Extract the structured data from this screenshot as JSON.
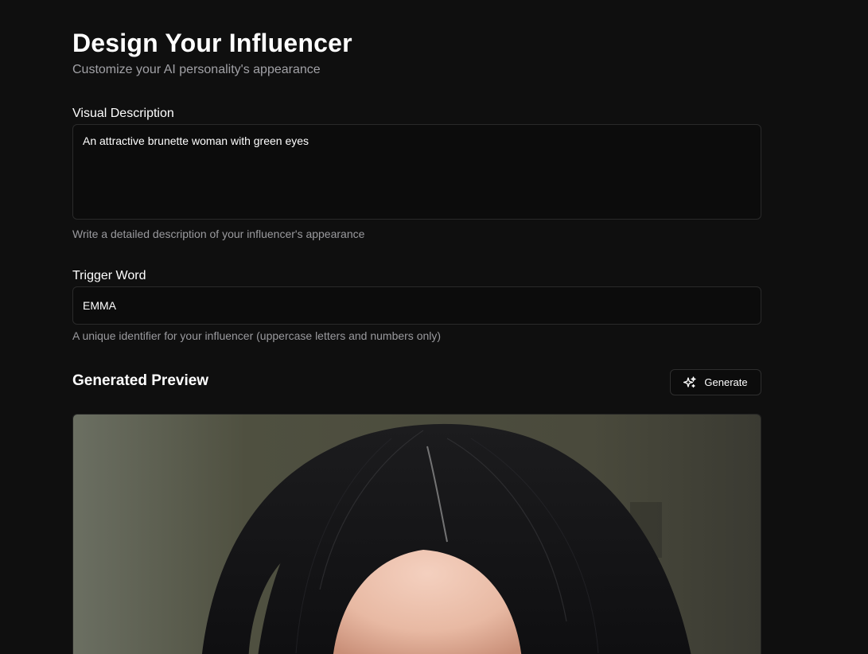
{
  "header": {
    "title": "Design Your Influencer",
    "subtitle": "Customize your AI personality's appearance"
  },
  "visual_description": {
    "label": "Visual Description",
    "value": "An attractive brunette woman with green eyes",
    "helper": "Write a detailed description of your influencer's appearance"
  },
  "trigger_word": {
    "label": "Trigger Word",
    "value": "EMMA",
    "helper": "A unique identifier for your influencer (uppercase letters and numbers only)"
  },
  "preview": {
    "title": "Generated Preview",
    "generate_label": "Generate",
    "generate_icon": "sparkles-icon"
  },
  "colors": {
    "background": "#0f0f0f",
    "text_primary": "#ffffff",
    "text_muted": "#9a9a9e",
    "border": "#2a2a2a"
  }
}
